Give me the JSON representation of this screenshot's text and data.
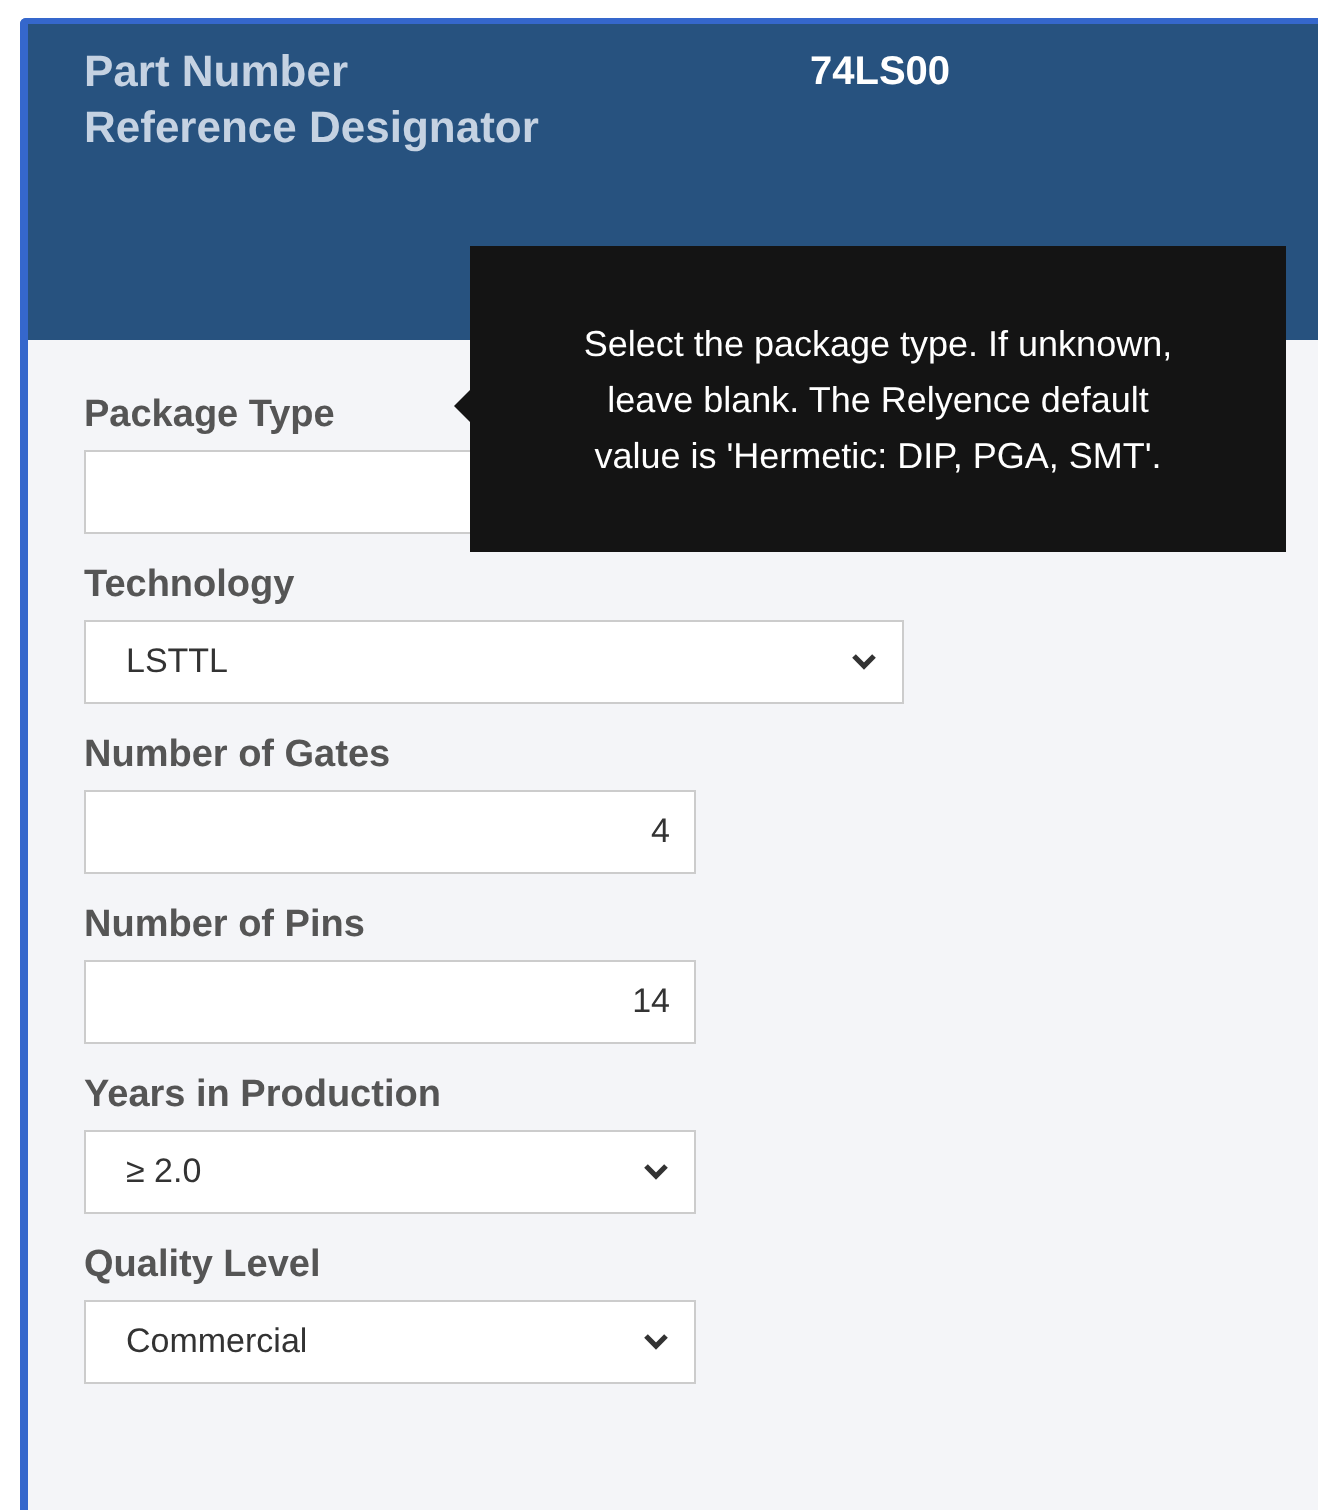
{
  "header": {
    "rows": [
      {
        "label": "Part Number",
        "value": "74LS00"
      },
      {
        "label": "Reference Designator"
      }
    ]
  },
  "tooltip": {
    "text": "Select the package type. If unknown, leave blank. The Relyence default value is 'Hermetic: DIP, PGA, SMT'."
  },
  "fields": [
    {
      "label": "Package Type",
      "kind": "text",
      "wide": false
    },
    {
      "label": "Technology",
      "kind": "select",
      "value": "LSTTL",
      "wide": true
    },
    {
      "label": "Number of Gates",
      "kind": "number",
      "value": "4",
      "wide": false
    },
    {
      "label": "Number of Pins",
      "kind": "number",
      "value": "14",
      "wide": false
    },
    {
      "label": "Years in Production",
      "kind": "select",
      "value": "≥ 2.0",
      "wide": false
    },
    {
      "label": "Quality Level",
      "kind": "select",
      "value": "Commercial",
      "wide": false
    }
  ]
}
